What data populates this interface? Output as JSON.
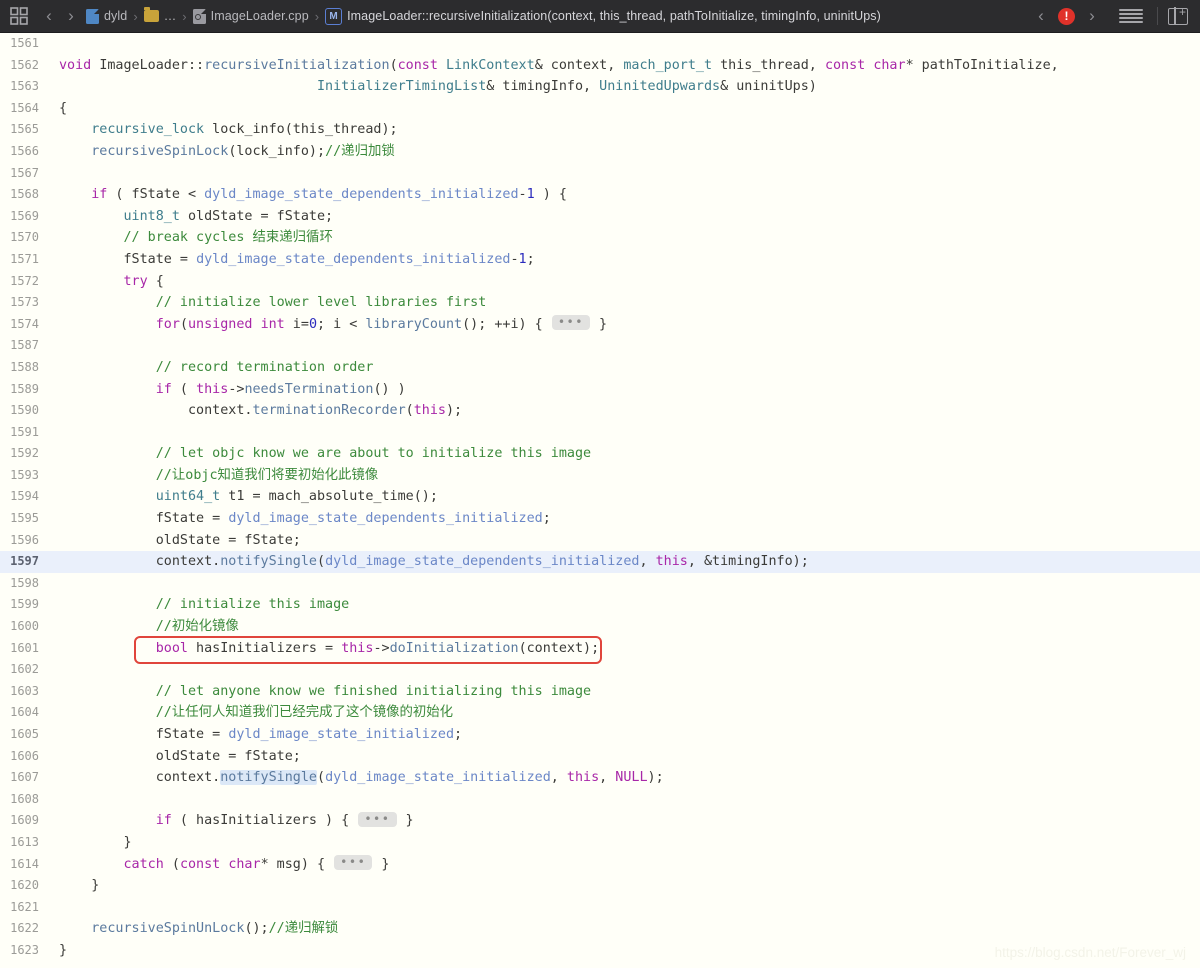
{
  "toolbar": {
    "grid_icon": "grid-icon",
    "back_label": "‹",
    "forward_label": "›",
    "breadcrumbs": [
      {
        "label": "dyld",
        "icon": "project-doc-icon"
      },
      {
        "label": "…",
        "icon": "folder-icon"
      },
      {
        "label": "ImageLoader.cpp",
        "icon": "cpp-file-icon"
      },
      {
        "label": "ImageLoader::recursiveInitialization(context, this_thread, pathToInitialize, timingInfo, uninitUps)",
        "icon": "method-badge-m"
      }
    ],
    "separator": "›",
    "method_badge": "M",
    "issue_prev": "‹",
    "issue_next": "›",
    "error_badge": "!",
    "minimap_icon": "lines-icon",
    "panel_icon": "add-editor-icon",
    "accent_blue": "#4f87c4",
    "error_red": "#e0322a"
  },
  "editor": {
    "highlighted_line": 1597,
    "red_box_line": 1601,
    "watermark": "https://blog.csdn.net/Forever_wj",
    "background": "#fffff8",
    "highlight_background": "#eaf0fb",
    "box_color": "#e0453c",
    "lines": [
      {
        "n": "1561",
        "tokens": []
      },
      {
        "n": "1562",
        "tokens": [
          {
            "t": "void",
            "c": "kw"
          },
          {
            "t": " ",
            "c": "plain"
          },
          {
            "t": "ImageLoader",
            "c": "plain"
          },
          {
            "t": "::",
            "c": "plain"
          },
          {
            "t": "recursiveInitialization",
            "c": "fn"
          },
          {
            "t": "(",
            "c": "plain"
          },
          {
            "t": "const",
            "c": "kw"
          },
          {
            "t": " ",
            "c": "plain"
          },
          {
            "t": "LinkContext",
            "c": "type"
          },
          {
            "t": "& context, ",
            "c": "plain"
          },
          {
            "t": "mach_port_t",
            "c": "type"
          },
          {
            "t": " this_thread, ",
            "c": "plain"
          },
          {
            "t": "const",
            "c": "kw"
          },
          {
            "t": " ",
            "c": "plain"
          },
          {
            "t": "char",
            "c": "kw"
          },
          {
            "t": "* pathToInitialize,",
            "c": "plain"
          }
        ]
      },
      {
        "n": "1563",
        "tokens": [
          {
            "t": "                                ",
            "c": "plain"
          },
          {
            "t": "InitializerTimingList",
            "c": "type"
          },
          {
            "t": "& timingInfo, ",
            "c": "plain"
          },
          {
            "t": "UninitedUpwards",
            "c": "type"
          },
          {
            "t": "& uninitUps)",
            "c": "plain"
          }
        ]
      },
      {
        "n": "1564",
        "tokens": [
          {
            "t": "{",
            "c": "plain"
          }
        ]
      },
      {
        "n": "1565",
        "tokens": [
          {
            "t": "    ",
            "c": "plain"
          },
          {
            "t": "recursive_lock",
            "c": "type"
          },
          {
            "t": " lock_info(this_thread);",
            "c": "plain"
          }
        ]
      },
      {
        "n": "1566",
        "tokens": [
          {
            "t": "    ",
            "c": "plain"
          },
          {
            "t": "recursiveSpinLock",
            "c": "fn"
          },
          {
            "t": "(lock_info);",
            "c": "plain"
          },
          {
            "t": "//递归加锁",
            "c": "cm"
          }
        ]
      },
      {
        "n": "1567",
        "tokens": []
      },
      {
        "n": "1568",
        "tokens": [
          {
            "t": "    ",
            "c": "plain"
          },
          {
            "t": "if",
            "c": "kw"
          },
          {
            "t": " ( fState < ",
            "c": "plain"
          },
          {
            "t": "dyld_image_state_dependents_initialized",
            "c": "enumc"
          },
          {
            "t": "-",
            "c": "plain"
          },
          {
            "t": "1",
            "c": "num"
          },
          {
            "t": " ) {",
            "c": "plain"
          }
        ]
      },
      {
        "n": "1569",
        "tokens": [
          {
            "t": "        ",
            "c": "plain"
          },
          {
            "t": "uint8_t",
            "c": "type"
          },
          {
            "t": " oldState = fState;",
            "c": "plain"
          }
        ]
      },
      {
        "n": "1570",
        "tokens": [
          {
            "t": "        ",
            "c": "plain"
          },
          {
            "t": "// break cycles 结束递归循环",
            "c": "cm"
          }
        ]
      },
      {
        "n": "1571",
        "tokens": [
          {
            "t": "        fState = ",
            "c": "plain"
          },
          {
            "t": "dyld_image_state_dependents_initialized",
            "c": "enumc"
          },
          {
            "t": "-",
            "c": "plain"
          },
          {
            "t": "1",
            "c": "num"
          },
          {
            "t": ";",
            "c": "plain"
          }
        ]
      },
      {
        "n": "1572",
        "tokens": [
          {
            "t": "        ",
            "c": "plain"
          },
          {
            "t": "try",
            "c": "kw"
          },
          {
            "t": " {",
            "c": "plain"
          }
        ]
      },
      {
        "n": "1573",
        "tokens": [
          {
            "t": "            ",
            "c": "plain"
          },
          {
            "t": "// initialize lower level libraries first",
            "c": "cm"
          }
        ]
      },
      {
        "n": "1574",
        "tokens": [
          {
            "t": "            ",
            "c": "plain"
          },
          {
            "t": "for",
            "c": "kw"
          },
          {
            "t": "(",
            "c": "plain"
          },
          {
            "t": "unsigned",
            "c": "kw"
          },
          {
            "t": " ",
            "c": "plain"
          },
          {
            "t": "int",
            "c": "kw"
          },
          {
            "t": " i=",
            "c": "plain"
          },
          {
            "t": "0",
            "c": "num"
          },
          {
            "t": "; i < ",
            "c": "plain"
          },
          {
            "t": "libraryCount",
            "c": "fn"
          },
          {
            "t": "(); ++i) { ",
            "c": "plain"
          },
          {
            "t": "•••",
            "c": "ell"
          },
          {
            "t": " }",
            "c": "plain"
          }
        ]
      },
      {
        "n": "1587",
        "tokens": []
      },
      {
        "n": "1588",
        "tokens": [
          {
            "t": "            ",
            "c": "plain"
          },
          {
            "t": "// record termination order",
            "c": "cm"
          }
        ]
      },
      {
        "n": "1589",
        "tokens": [
          {
            "t": "            ",
            "c": "plain"
          },
          {
            "t": "if",
            "c": "kw"
          },
          {
            "t": " ( ",
            "c": "plain"
          },
          {
            "t": "this",
            "c": "kw"
          },
          {
            "t": "->",
            "c": "plain"
          },
          {
            "t": "needsTermination",
            "c": "fn"
          },
          {
            "t": "() )",
            "c": "plain"
          }
        ]
      },
      {
        "n": "1590",
        "tokens": [
          {
            "t": "                context.",
            "c": "plain"
          },
          {
            "t": "terminationRecorder",
            "c": "fn"
          },
          {
            "t": "(",
            "c": "plain"
          },
          {
            "t": "this",
            "c": "kw"
          },
          {
            "t": ");",
            "c": "plain"
          }
        ]
      },
      {
        "n": "1591",
        "tokens": []
      },
      {
        "n": "1592",
        "tokens": [
          {
            "t": "            ",
            "c": "plain"
          },
          {
            "t": "// let objc know we are about to initialize this image",
            "c": "cm"
          }
        ]
      },
      {
        "n": "1593",
        "tokens": [
          {
            "t": "            ",
            "c": "plain"
          },
          {
            "t": "//让objc知道我们将要初始化此镜像",
            "c": "cm"
          }
        ]
      },
      {
        "n": "1594",
        "tokens": [
          {
            "t": "            ",
            "c": "plain"
          },
          {
            "t": "uint64_t",
            "c": "type"
          },
          {
            "t": " t1 = mach_absolute_time();",
            "c": "plain"
          }
        ]
      },
      {
        "n": "1595",
        "tokens": [
          {
            "t": "            fState = ",
            "c": "plain"
          },
          {
            "t": "dyld_image_state_dependents_initialized",
            "c": "enumc"
          },
          {
            "t": ";",
            "c": "plain"
          }
        ]
      },
      {
        "n": "1596",
        "tokens": [
          {
            "t": "            oldState = fState;",
            "c": "plain"
          }
        ]
      },
      {
        "n": "1597",
        "tokens": [
          {
            "t": "            context.",
            "c": "plain"
          },
          {
            "t": "notifySingle",
            "c": "fn"
          },
          {
            "t": "(",
            "c": "plain"
          },
          {
            "t": "dyld_image_state_dependents_initialized",
            "c": "enumc"
          },
          {
            "t": ", ",
            "c": "plain"
          },
          {
            "t": "this",
            "c": "kw"
          },
          {
            "t": ", &timingInfo);",
            "c": "plain"
          }
        ]
      },
      {
        "n": "1598",
        "tokens": []
      },
      {
        "n": "1599",
        "tokens": [
          {
            "t": "            ",
            "c": "plain"
          },
          {
            "t": "// initialize this image",
            "c": "cm"
          }
        ]
      },
      {
        "n": "1600",
        "tokens": [
          {
            "t": "            ",
            "c": "plain"
          },
          {
            "t": "//初始化镜像",
            "c": "cm"
          }
        ]
      },
      {
        "n": "1601",
        "tokens": [
          {
            "t": "            ",
            "c": "plain"
          },
          {
            "t": "bool",
            "c": "kw"
          },
          {
            "t": " hasInitializers = ",
            "c": "plain"
          },
          {
            "t": "this",
            "c": "kw"
          },
          {
            "t": "->",
            "c": "plain"
          },
          {
            "t": "doInitialization",
            "c": "fn"
          },
          {
            "t": "(context);",
            "c": "plain"
          }
        ]
      },
      {
        "n": "1602",
        "tokens": []
      },
      {
        "n": "1603",
        "tokens": [
          {
            "t": "            ",
            "c": "plain"
          },
          {
            "t": "// let anyone know we finished initializing this image",
            "c": "cm"
          }
        ]
      },
      {
        "n": "1604",
        "tokens": [
          {
            "t": "            ",
            "c": "plain"
          },
          {
            "t": "//让任何人知道我们已经完成了这个镜像的初始化",
            "c": "cm"
          }
        ]
      },
      {
        "n": "1605",
        "tokens": [
          {
            "t": "            fState = ",
            "c": "plain"
          },
          {
            "t": "dyld_image_state_initialized",
            "c": "enumc"
          },
          {
            "t": ";",
            "c": "plain"
          }
        ]
      },
      {
        "n": "1606",
        "tokens": [
          {
            "t": "            oldState = fState;",
            "c": "plain"
          }
        ]
      },
      {
        "n": "1607",
        "tokens": [
          {
            "t": "            context.",
            "c": "plain"
          },
          {
            "t": "notifySingle",
            "c": "fn-sel"
          },
          {
            "t": "(",
            "c": "plain"
          },
          {
            "t": "dyld_image_state_initialized",
            "c": "enumc"
          },
          {
            "t": ", ",
            "c": "plain"
          },
          {
            "t": "this",
            "c": "kw"
          },
          {
            "t": ", ",
            "c": "plain"
          },
          {
            "t": "NULL",
            "c": "kw"
          },
          {
            "t": ");",
            "c": "plain"
          }
        ]
      },
      {
        "n": "1608",
        "tokens": []
      },
      {
        "n": "1609",
        "tokens": [
          {
            "t": "            ",
            "c": "plain"
          },
          {
            "t": "if",
            "c": "kw"
          },
          {
            "t": " ( hasInitializers ) { ",
            "c": "plain"
          },
          {
            "t": "•••",
            "c": "ell"
          },
          {
            "t": " }",
            "c": "plain"
          }
        ]
      },
      {
        "n": "1613",
        "tokens": [
          {
            "t": "        }",
            "c": "plain"
          }
        ]
      },
      {
        "n": "1614",
        "tokens": [
          {
            "t": "        ",
            "c": "plain"
          },
          {
            "t": "catch",
            "c": "kw"
          },
          {
            "t": " (",
            "c": "plain"
          },
          {
            "t": "const",
            "c": "kw"
          },
          {
            "t": " ",
            "c": "plain"
          },
          {
            "t": "char",
            "c": "kw"
          },
          {
            "t": "* msg) { ",
            "c": "plain"
          },
          {
            "t": "•••",
            "c": "ell"
          },
          {
            "t": " }",
            "c": "plain"
          }
        ]
      },
      {
        "n": "1620",
        "tokens": [
          {
            "t": "    }",
            "c": "plain"
          }
        ]
      },
      {
        "n": "1621",
        "tokens": []
      },
      {
        "n": "1622",
        "tokens": [
          {
            "t": "    ",
            "c": "plain"
          },
          {
            "t": "recursiveSpinUnLock",
            "c": "fn"
          },
          {
            "t": "();",
            "c": "plain"
          },
          {
            "t": "//递归解锁",
            "c": "cm"
          }
        ]
      },
      {
        "n": "1623",
        "tokens": [
          {
            "t": "}",
            "c": "plain"
          }
        ]
      }
    ]
  }
}
